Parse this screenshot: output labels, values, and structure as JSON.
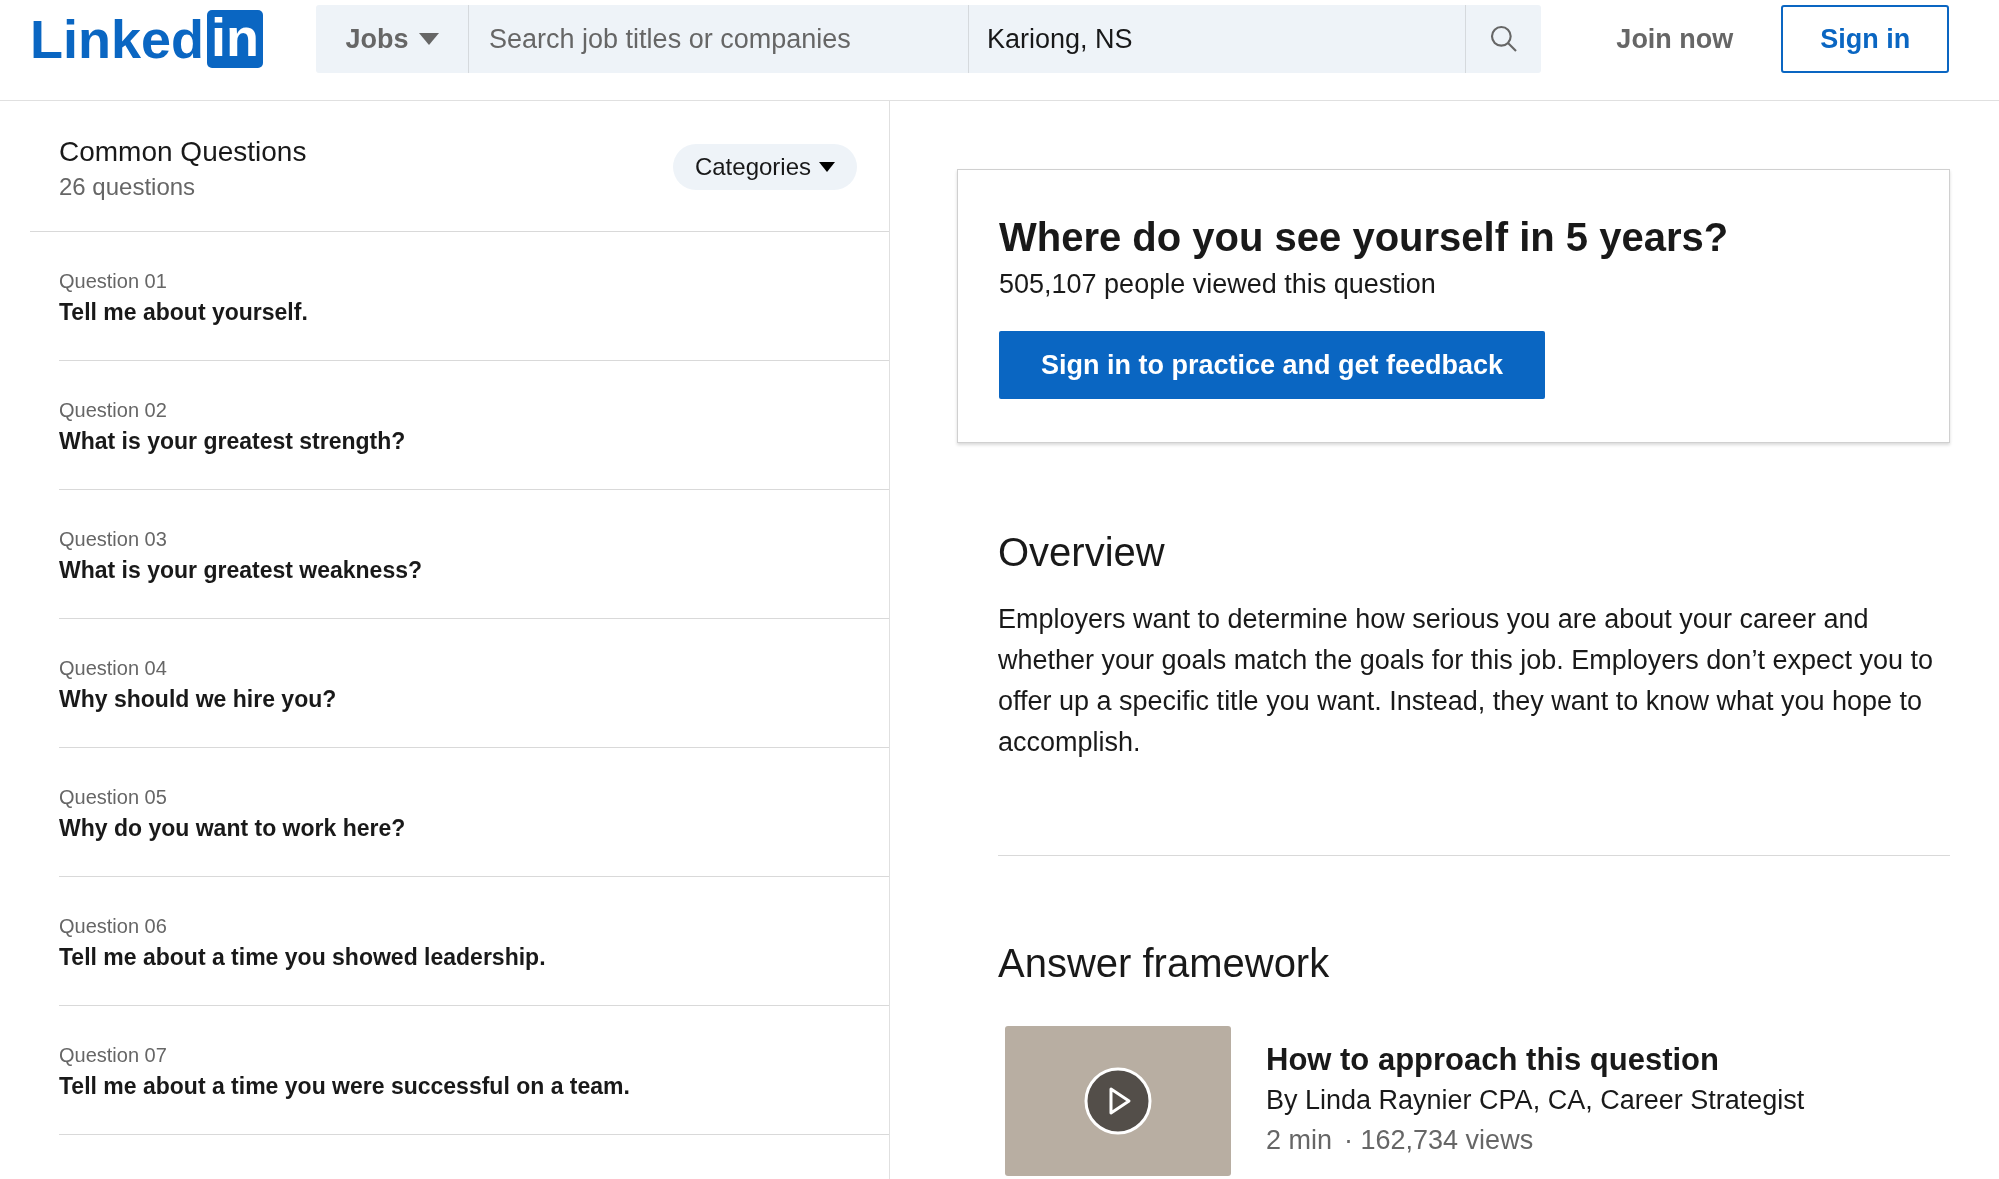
{
  "header": {
    "logo": {
      "word": "Linked",
      "box": "in"
    },
    "search": {
      "category": "Jobs",
      "placeholder": "Search job titles or companies",
      "location": "Kariong, NS"
    },
    "join": "Join now",
    "sign_in": "Sign in"
  },
  "sidebar": {
    "title": "Common Questions",
    "count": "26 questions",
    "categories": "Categories",
    "questions": [
      {
        "label": "Question 01",
        "text": "Tell me about yourself."
      },
      {
        "label": "Question 02",
        "text": "What is your greatest strength?"
      },
      {
        "label": "Question 03",
        "text": "What is your greatest weakness?"
      },
      {
        "label": "Question 04",
        "text": "Why should we hire you?"
      },
      {
        "label": "Question 05",
        "text": "Why do you want to work here?"
      },
      {
        "label": "Question 06",
        "text": "Tell me about a time you showed leadership."
      },
      {
        "label": "Question 07",
        "text": "Tell me about a time you were successful on a team."
      }
    ]
  },
  "question": {
    "title": "Where do you see yourself in 5 years?",
    "views": "505,107 people viewed this question",
    "button": "Sign in to practice and get feedback"
  },
  "overview": {
    "heading": "Overview",
    "text": "Employers want to determine how serious you are about your career and whether your goals match the goals for this job. Employers don’t expect you to offer up a specific title you want. Instead, they want to know what you hope to accomplish."
  },
  "framework": {
    "heading": "Answer framework",
    "video": {
      "title": "How to approach this question",
      "author": "By Linda Raynier CPA, CA, Career Strategist",
      "duration": "2 min",
      "views": "· 162,734 views"
    }
  }
}
